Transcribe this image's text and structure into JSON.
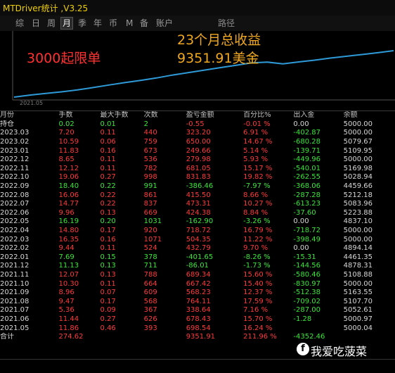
{
  "window": {
    "title": "MTDriver统计 ,V3.25"
  },
  "tabs": [
    {
      "label": "综",
      "active": false
    },
    {
      "label": "日",
      "active": false
    },
    {
      "label": "周",
      "active": false
    },
    {
      "label": "月",
      "active": true
    },
    {
      "label": "季",
      "active": false
    },
    {
      "label": "年",
      "active": false
    },
    {
      "label": "币",
      "active": false
    },
    {
      "label": "M",
      "active": false
    },
    {
      "label": "备",
      "active": false
    },
    {
      "label": "账户",
      "active": false
    },
    {
      "label": "路径",
      "active": false
    }
  ],
  "overlay": {
    "left_note": "3000起限单",
    "headline_1": "23个月总收益",
    "headline_2": "9351.91美金"
  },
  "chart_data": {
    "type": "area",
    "x_start_label": "2021.05",
    "note": "cumulative balance curve, rising from left to right",
    "values": [
      5000,
      5350,
      5620,
      5890,
      6210,
      6620,
      7040,
      7450,
      7830,
      8240,
      8720,
      9130,
      9540,
      9960,
      10360,
      10780,
      10920,
      10620,
      10950,
      11250,
      11600,
      11900,
      12200,
      12500,
      12850
    ]
  },
  "table": {
    "headers": [
      "月份",
      "手数",
      "最大手数",
      "次数",
      "盈亏金额",
      "百分比%",
      "出入金",
      "余额"
    ],
    "holding": [
      "持仓",
      "0.02",
      "0.01",
      "2",
      "-0.55",
      "-0.01 %",
      "0.00",
      "5000.00"
    ],
    "rows": [
      [
        "2023.03",
        "7.20",
        "0.11",
        "440",
        "323.20",
        "6.91 %",
        "-402.87",
        "5000.00"
      ],
      [
        "2023.02",
        "10.59",
        "0.06",
        "759",
        "650.00",
        "14.67 %",
        "-680.28",
        "5079.67"
      ],
      [
        "2023.01",
        "11.83",
        "0.16",
        "673",
        "249.66",
        "5.14 %",
        "-139.71",
        "5109.95"
      ],
      [
        "2022.12",
        "8.65",
        "0.11",
        "536",
        "279.98",
        "5.93 %",
        "-449.96",
        "5000.00"
      ],
      [
        "2022.11",
        "12.12",
        "0.11",
        "782",
        "681.05",
        "15.17 %",
        "-540.01",
        "5169.98"
      ],
      [
        "2022.10",
        "19.06",
        "0.27",
        "998",
        "831.83",
        "19.82 %",
        "-262.55",
        "5028.94"
      ],
      [
        "2022.09",
        "18.40",
        "0.22",
        "991",
        "-386.46",
        "-7.97 %",
        "-368.06",
        "4459.66"
      ],
      [
        "2022.08",
        "16.06",
        "0.22",
        "861",
        "415.50",
        "8.66 %",
        "-287.28",
        "5212.18"
      ],
      [
        "2022.07",
        "14.77",
        "0.22",
        "837",
        "473.31",
        "10.27 %",
        "-613.23",
        "5083.96"
      ],
      [
        "2022.06",
        "9.96",
        "0.13",
        "669",
        "424.38",
        "8.84 %",
        "-37.60",
        "5223.88"
      ],
      [
        "2022.05",
        "16.19",
        "0.20",
        "1031",
        "-162.90",
        "-3.26 %",
        "0.00",
        "4837.10"
      ],
      [
        "2022.04",
        "14.80",
        "0.17",
        "920",
        "718.72",
        "16.79 %",
        "-718.72",
        "5000.00"
      ],
      [
        "2022.03",
        "16.35",
        "0.16",
        "1071",
        "504.35",
        "11.22 %",
        "-398.49",
        "5000.00"
      ],
      [
        "2022.02",
        "9.44",
        "0.11",
        "524",
        "432.79",
        "9.70 %",
        "0.00",
        "4894.14"
      ],
      [
        "2022.01",
        "7.69",
        "0.15",
        "378",
        "-401.65",
        "-8.26 %",
        "-15.31",
        "4461.35"
      ],
      [
        "2021.12",
        "11.13",
        "0.13",
        "711",
        "-86.01",
        "-1.73 %",
        "-144.56",
        "4878.31"
      ],
      [
        "2021.11",
        "12.07",
        "0.13",
        "788",
        "689.34",
        "15.60 %",
        "-580.46",
        "5108.88"
      ],
      [
        "2021.10",
        "10.30",
        "0.11",
        "664",
        "667.42",
        "15.40 %",
        "-830.97",
        "5000.00"
      ],
      [
        "2021.09",
        "8.96",
        "0.07",
        "609",
        "568.23",
        "12.37 %",
        "-512.38",
        "5163.55"
      ],
      [
        "2021.08",
        "9.47",
        "0.17",
        "568",
        "764.11",
        "17.59 %",
        "-709.02",
        "5107.70"
      ],
      [
        "2021.07",
        "5.36",
        "0.09",
        "367",
        "338.64",
        "7.16 %",
        "-287.00",
        "5052.61"
      ],
      [
        "2021.06",
        "11.44",
        "0.27",
        "626",
        "678.43",
        "15.70 %",
        "-1.28",
        "5000.97"
      ],
      [
        "2021.05",
        "11.86",
        "0.46",
        "393",
        "698.54",
        "16.24 %",
        "",
        "5000.04"
      ]
    ],
    "total": [
      "合计",
      "274.62",
      "",
      "",
      "9351.91",
      "211.96 %",
      "-4352.46",
      ""
    ]
  },
  "watermark": {
    "text": "我爱吃菠菜"
  },
  "colors": {
    "profit": "#ff3a3a",
    "loss": "#3ae63a",
    "title": "#f0d000",
    "headline": "#f0a820",
    "curve": "#2e9ad8"
  }
}
